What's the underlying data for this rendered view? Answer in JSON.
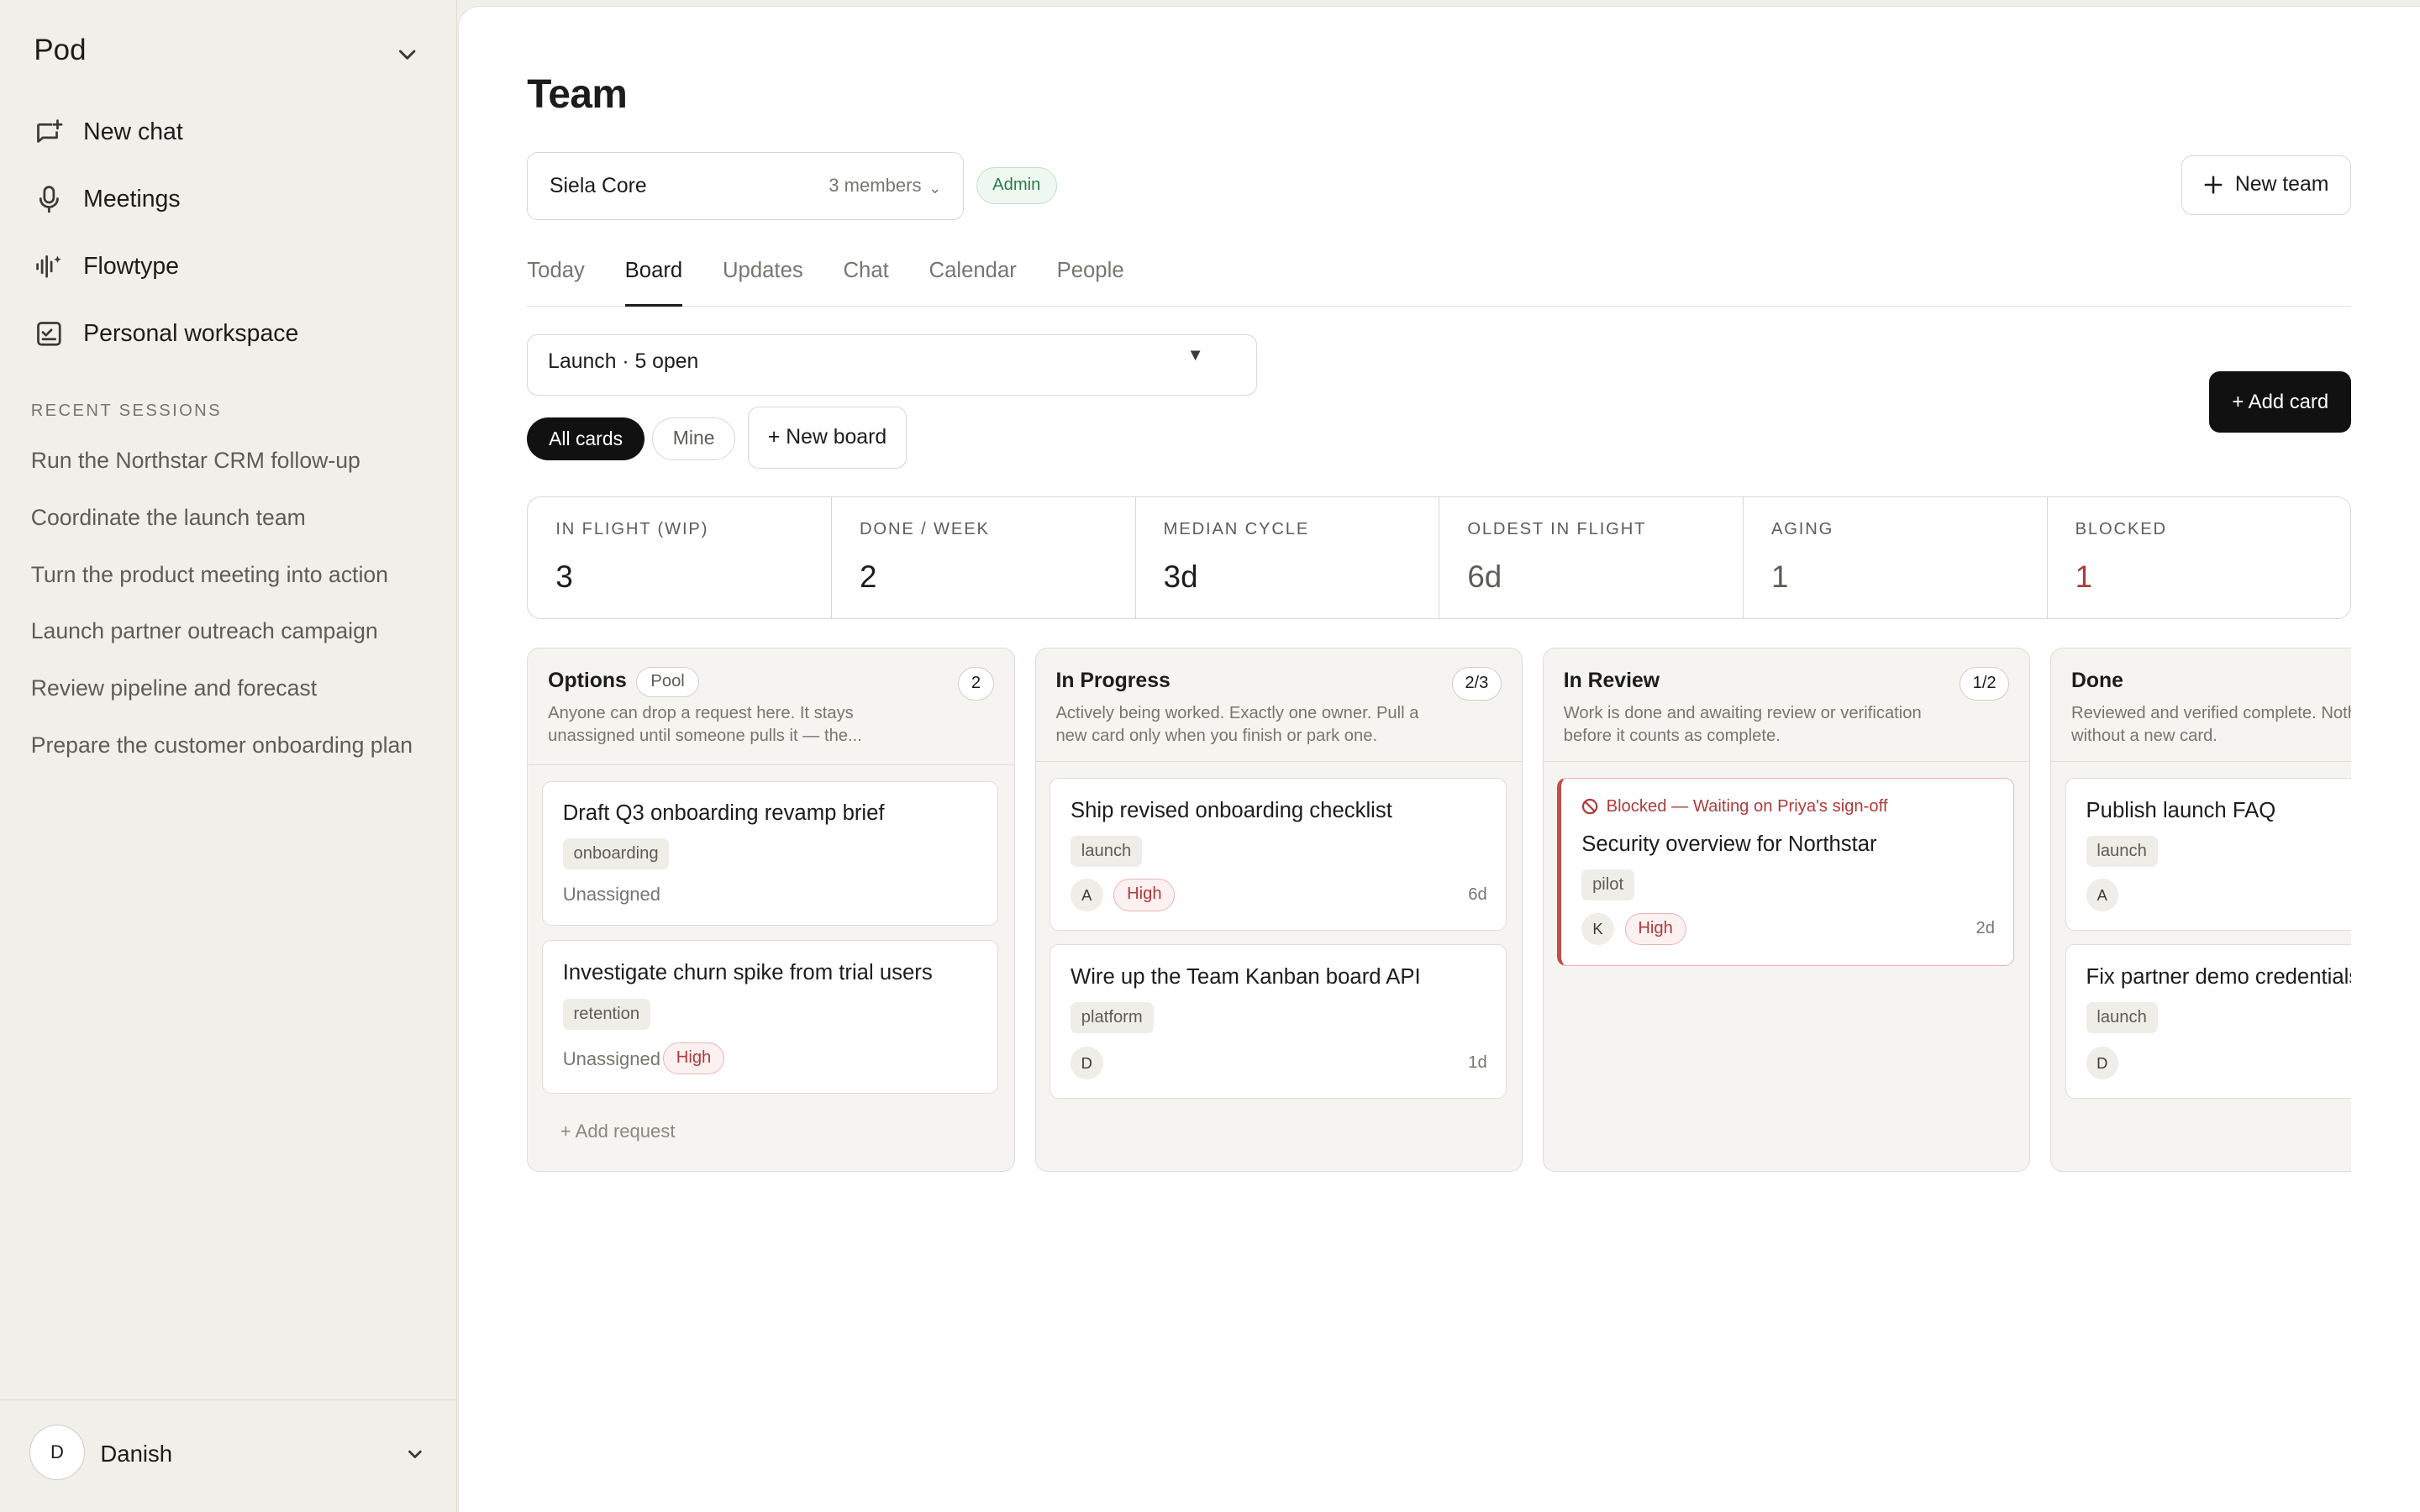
{
  "sidebar": {
    "brand": "Pod",
    "nav": [
      {
        "label": "New chat",
        "icon": "new-chat-icon"
      },
      {
        "label": "Meetings",
        "icon": "microphone-icon"
      },
      {
        "label": "Flowtype",
        "icon": "waveform-icon"
      },
      {
        "label": "Personal workspace",
        "icon": "workspace-icon"
      }
    ],
    "section_label": "RECENT SESSIONS",
    "sessions": [
      "Run the Northstar CRM follow-up",
      "Coordinate the launch team",
      "Turn the product meeting into action",
      "Launch partner outreach campaign",
      "Review pipeline and forecast",
      "Prepare the customer onboarding plan"
    ],
    "user": {
      "initial": "D",
      "name": "Danish"
    }
  },
  "header": {
    "title": "Team",
    "team_name": "Siela Core",
    "team_members": "3 members",
    "role_badge": "Admin",
    "new_team_label": "New team"
  },
  "tabs": [
    "Today",
    "Board",
    "Updates",
    "Chat",
    "Calendar",
    "People"
  ],
  "active_tab": "Board",
  "board_select": "Launch · 5 open",
  "add_card_label": "+ Add card",
  "filters": {
    "all": "All cards",
    "mine": "Mine",
    "new_board": "+ New board"
  },
  "stats": [
    {
      "label": "IN FLIGHT (WIP)",
      "value": "3",
      "color": "#1c1c1a"
    },
    {
      "label": "DONE / WEEK",
      "value": "2",
      "color": "#1c1c1a"
    },
    {
      "label": "MEDIAN CYCLE",
      "value": "3d",
      "color": "#1c1c1a"
    },
    {
      "label": "OLDEST IN FLIGHT",
      "value": "6d",
      "color": "#5e5c57"
    },
    {
      "label": "AGING",
      "value": "1",
      "color": "#5e5c57"
    },
    {
      "label": "BLOCKED",
      "value": "1",
      "color": "#b03a3a"
    }
  ],
  "columns": [
    {
      "title": "Options",
      "tag": "Pool",
      "count": "2",
      "desc": "Anyone can drop a request here. It stays unassigned until someone pulls it — the...",
      "cards": [
        {
          "title": "Draft Q3 onboarding revamp brief",
          "tag": "onboarding",
          "assignee_text": "Unassigned"
        },
        {
          "title": "Investigate churn spike from trial users",
          "tag": "retention",
          "assignee_text": "Unassigned",
          "priority": "High"
        }
      ],
      "add_request": "+ Add request"
    },
    {
      "title": "In Progress",
      "count": "2/3",
      "desc": "Actively being worked. Exactly one owner. Pull a new card only when you finish or park one.",
      "cards": [
        {
          "title": "Ship revised onboarding checklist",
          "tag": "launch",
          "avatar": "A",
          "priority": "High",
          "age": "6d"
        },
        {
          "title": "Wire up the Team Kanban board API",
          "tag": "platform",
          "avatar": "D",
          "age": "1d"
        }
      ]
    },
    {
      "title": "In Review",
      "count": "1/2",
      "desc": "Work is done and awaiting review or verification before it counts as complete.",
      "cards": [
        {
          "blocked": "Blocked — Waiting on Priya's sign-off",
          "title": "Security overview for Northstar",
          "tag": "pilot",
          "avatar": "K",
          "priority": "High",
          "age": "2d"
        }
      ]
    },
    {
      "title": "Done",
      "desc": "Reviewed and verified complete. Nothing re-opens from here without a new card.",
      "cards": [
        {
          "title": "Publish launch FAQ",
          "tag": "launch",
          "avatar": "A"
        },
        {
          "title": "Fix partner demo credentials",
          "tag": "launch",
          "avatar": "D"
        }
      ]
    }
  ]
}
